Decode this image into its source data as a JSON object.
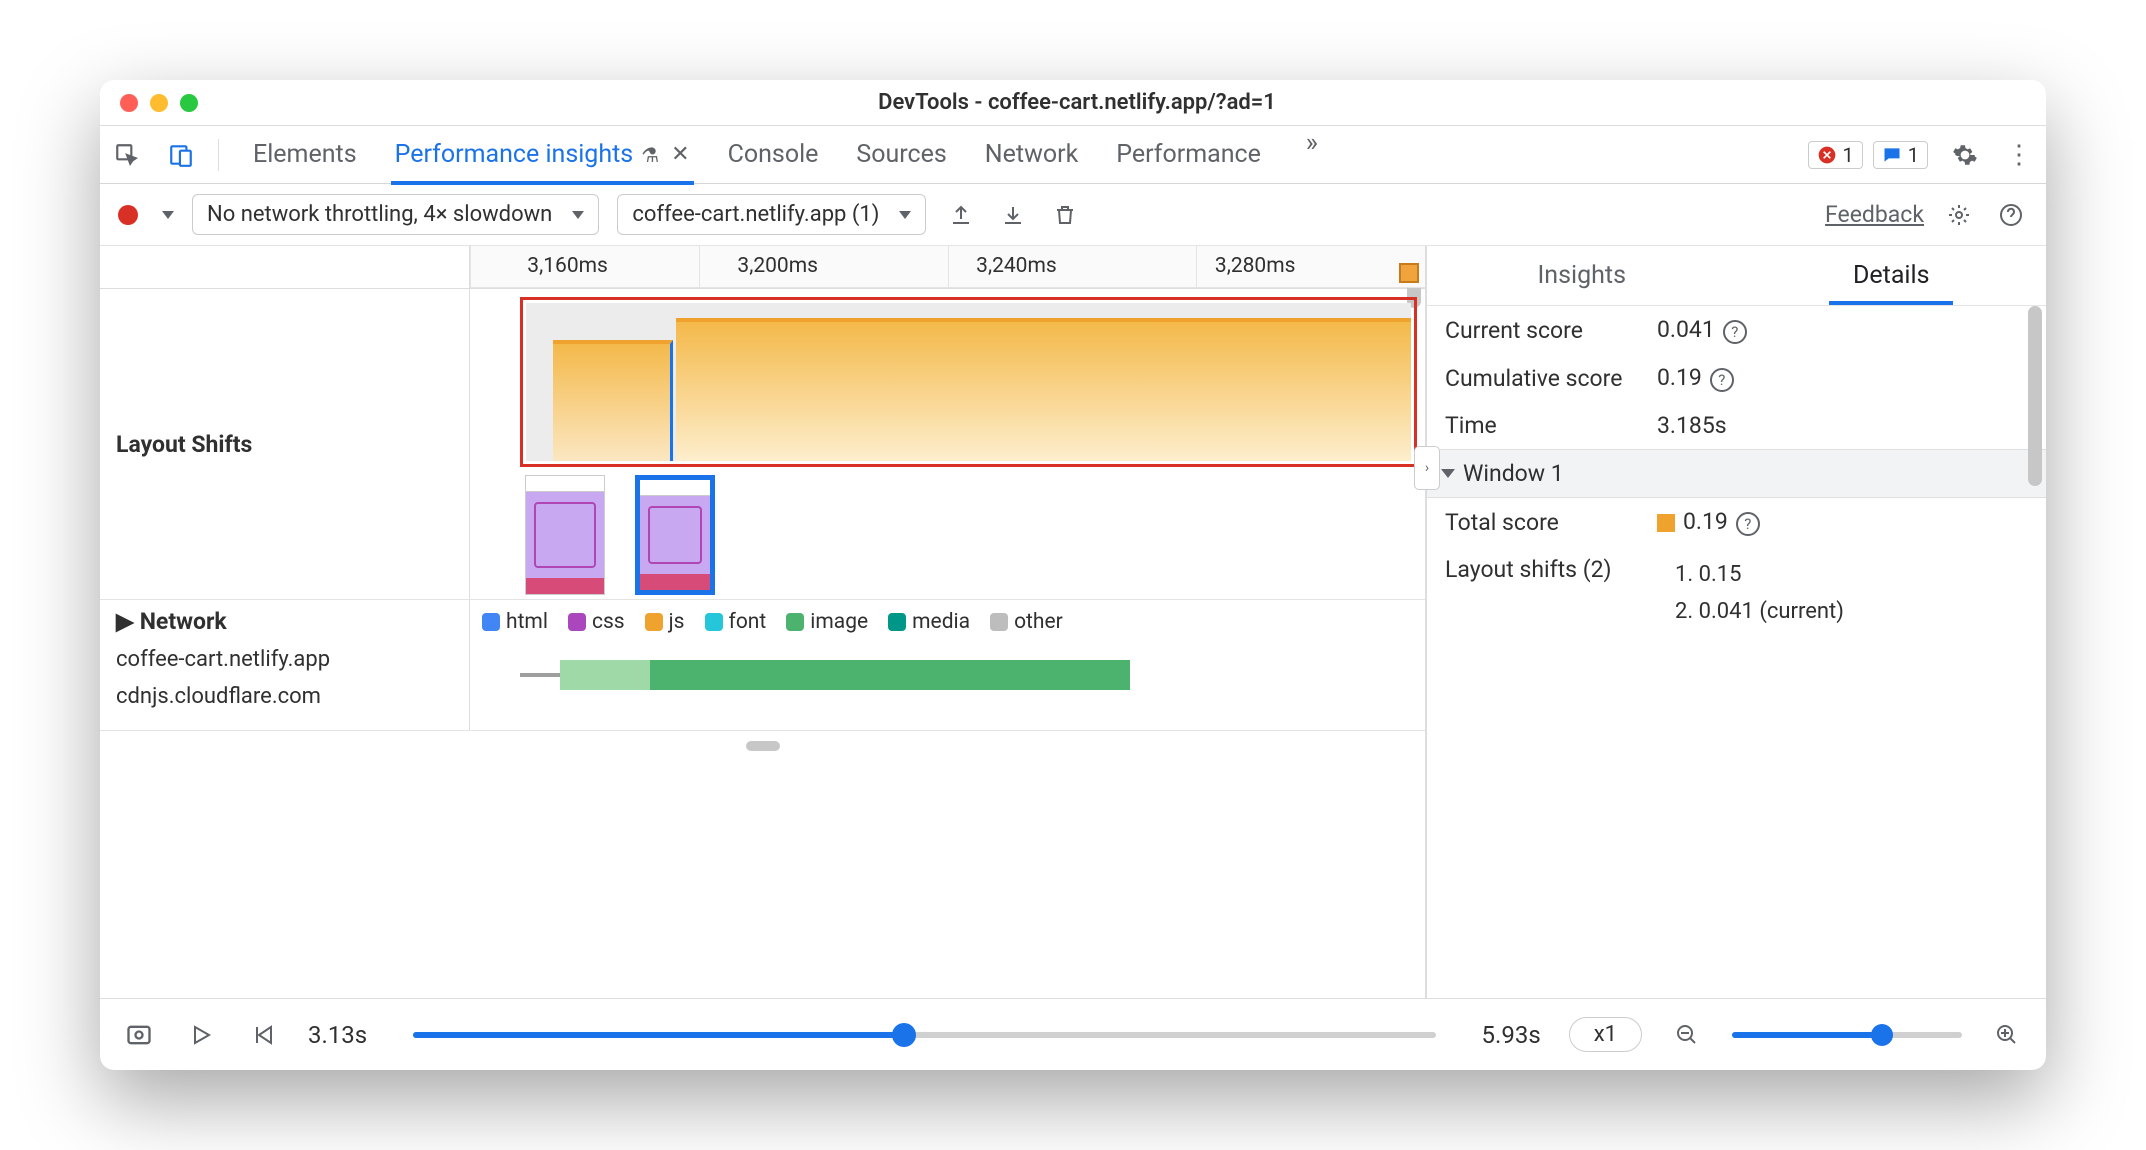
{
  "window": {
    "title": "DevTools - coffee-cart.netlify.app/?ad=1"
  },
  "tabs": {
    "items": [
      "Elements",
      "Performance insights",
      "Console",
      "Sources",
      "Network",
      "Performance"
    ],
    "activeIndex": 1
  },
  "top_badges": {
    "errors": "1",
    "messages": "1"
  },
  "toolbar": {
    "throttling": "No network throttling, 4× slowdown",
    "recording_select": "coffee-cart.netlify.app (1)",
    "feedback": "Feedback"
  },
  "timeline": {
    "ticks": [
      "3,160ms",
      "3,200ms",
      "3,240ms",
      "3,280ms"
    ],
    "layout_shifts_label": "Layout Shifts",
    "network_label": "Network",
    "legend": {
      "html": {
        "label": "html",
        "color": "#4285f4"
      },
      "css": {
        "label": "css",
        "color": "#ab47bc"
      },
      "js": {
        "label": "js",
        "color": "#f0a22e"
      },
      "font": {
        "label": "font",
        "color": "#26c6da"
      },
      "image": {
        "label": "image",
        "color": "#4cb36e"
      },
      "media": {
        "label": "media",
        "color": "#009688"
      },
      "other": {
        "label": "other",
        "color": "#bdbdbd"
      }
    },
    "hosts": [
      "coffee-cart.netlify.app",
      "cdnjs.cloudflare.com"
    ]
  },
  "right_panel": {
    "tabs": [
      "Insights",
      "Details"
    ],
    "activeIndex": 1,
    "current_score_label": "Current score",
    "current_score": "0.041",
    "cum_score_label": "Cumulative score",
    "cum_score": "0.19",
    "time_label": "Time",
    "time": "3.185s",
    "window_header": "Window 1",
    "total_score_label": "Total score",
    "total_score": "0.19",
    "layout_shifts_label": "Layout shifts (2)",
    "shifts": [
      "1. 0.15",
      "2. 0.041 (current)"
    ]
  },
  "footer": {
    "start": "3.13s",
    "end": "5.93s",
    "zoom_chip": "x1"
  }
}
